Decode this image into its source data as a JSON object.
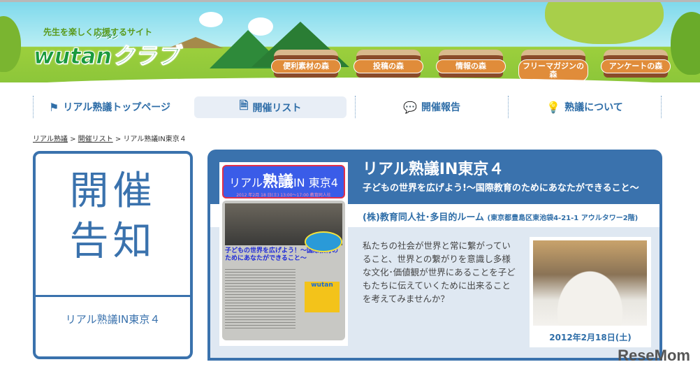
{
  "header": {
    "tagline": "先生を楽しく応援するサイト",
    "logo": "wutanクラブ",
    "logo_ruby": "ウータン",
    "forests": [
      "便利素材の森",
      "投稿の森",
      "情報の森",
      "フリーマガジンの森",
      "アンケートの森"
    ]
  },
  "nav": [
    {
      "label": "リアル熟議トップページ",
      "icon": "flag-icon"
    },
    {
      "label": "開催リスト",
      "icon": "document-icon",
      "active": true
    },
    {
      "label": "開催報告",
      "icon": "speech-bubble-icon"
    },
    {
      "label": "熟議について",
      "icon": "lightbulb-icon"
    }
  ],
  "breadcrumb": {
    "items": [
      "リアル熟議",
      "開催リスト"
    ],
    "current": "リアル熟議IN東京４",
    "sep": " > "
  },
  "left": {
    "title1": "開催",
    "title2": "告知",
    "name": "リアル熟議IN東京４"
  },
  "event": {
    "title": "リアル熟議IN東京４",
    "subtitle": "子どもの世界を広げよう!～国際教育のためにあなたができること～",
    "venue": "(株)教育同人社･多目的ルーム",
    "address": "(東京都豊島区東池袋4-21-1 アウルタワー2階)",
    "description": "私たちの社会が世界と常に繋がっていること、世界との繋がりを意識し多様な文化･価値観が世界にあることを子どもたちに伝えていくために出来ることを考えてみませんか？",
    "date": "2012年2月18日(土)"
  },
  "flyer": {
    "title_a": "リアル",
    "title_b": "熟議",
    "title_c": "IN 東京4",
    "date": "2012 年2月 18 日(土) 13:00～17:00 教育同人社",
    "theme": "子どもの世界を広げよう！～国際教育のためにあなたができること～",
    "badge": "wutan"
  },
  "watermark": "ReseMom"
}
